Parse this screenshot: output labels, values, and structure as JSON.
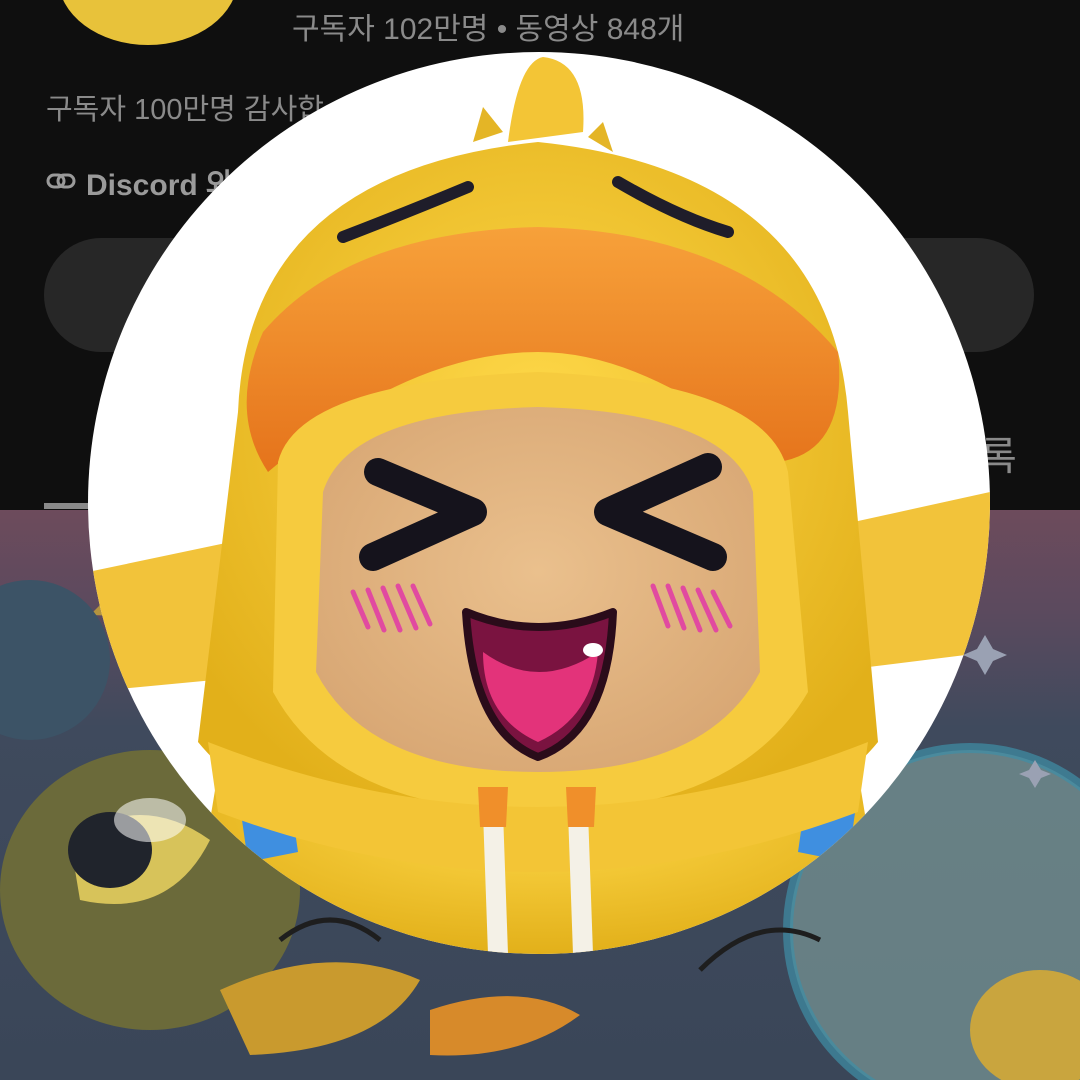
{
  "channel": {
    "meta": "구독자 102만명 • 동영상 848개",
    "description": "구독자 100만명 감사합",
    "link_text": "Discord 와",
    "right_fragment": "록"
  },
  "icons": {
    "link": "link-icon",
    "avatar": "duck-hood-avatar"
  },
  "colors": {
    "background": "#0f0f0f",
    "secondary_text": "#8a8a8a",
    "pill": "#272727",
    "hood_yellow": "#f5c93a",
    "bill_orange": "#f08a24"
  }
}
